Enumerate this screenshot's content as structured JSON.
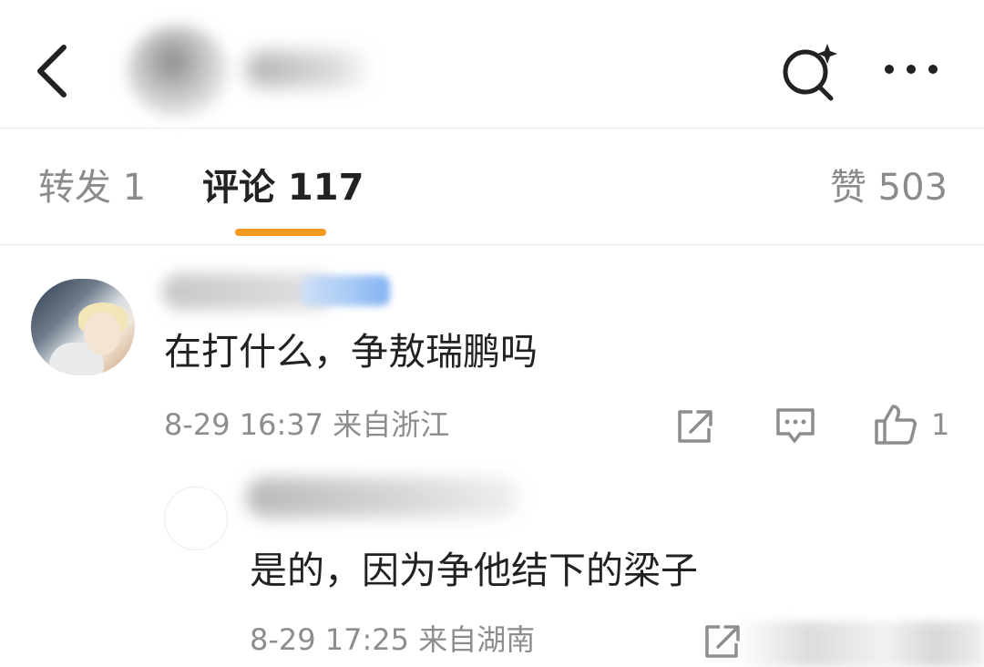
{
  "tabs": {
    "repost": "转发 1",
    "comments": "评论 117",
    "likes": "赞 503"
  },
  "comments": [
    {
      "text": "在打什么，争敖瑞鹏吗",
      "meta": "8-29 16:37 来自浙江",
      "like_count": "1",
      "replies": [
        {
          "text": "是的，因为争他结下的梁子",
          "meta": "8-29 17:25 来自湖南"
        }
      ]
    }
  ],
  "colors": {
    "accent": "#f39a1f",
    "secondary_text": "#8d8d8d",
    "divider": "#ececec"
  },
  "icons": [
    "back-arrow-icon",
    "search-sparkle-icon",
    "more-dots-icon",
    "share-icon",
    "comment-reply-icon",
    "thumbs-up-icon"
  ]
}
